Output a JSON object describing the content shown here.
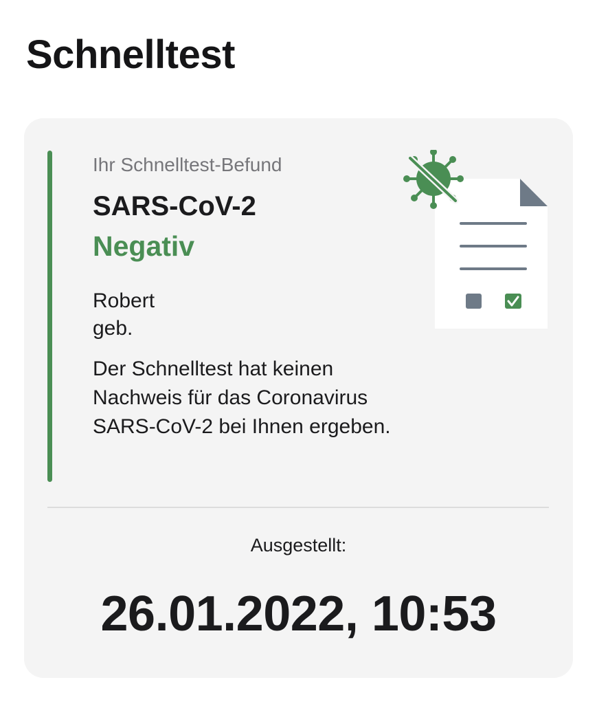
{
  "header": {
    "title": "Schnelltest"
  },
  "card": {
    "caption": "Ihr Schnelltest-Befund",
    "test_name": "SARS-CoV-2",
    "result": "Negativ",
    "person_name": "Robert",
    "birth_label": "geb.",
    "description": "Der Schnelltest hat keinen Nachweis für das Coronavirus SARS-CoV-2 bei Ihnen ergeben.",
    "issued_label": "Ausgestellt:",
    "issued_datetime": "26.01.2022, 10:53"
  },
  "icons": {
    "illustration": "document-with-crossed-virus-icon",
    "virus": "virus-icon",
    "checkbox_checked": "checkbox-checked-icon",
    "checkbox_empty": "checkbox-empty-icon"
  },
  "colors": {
    "accent_green": "#4a8e54",
    "card_background": "#f4f4f4",
    "document_gray": "#6e7a87"
  }
}
